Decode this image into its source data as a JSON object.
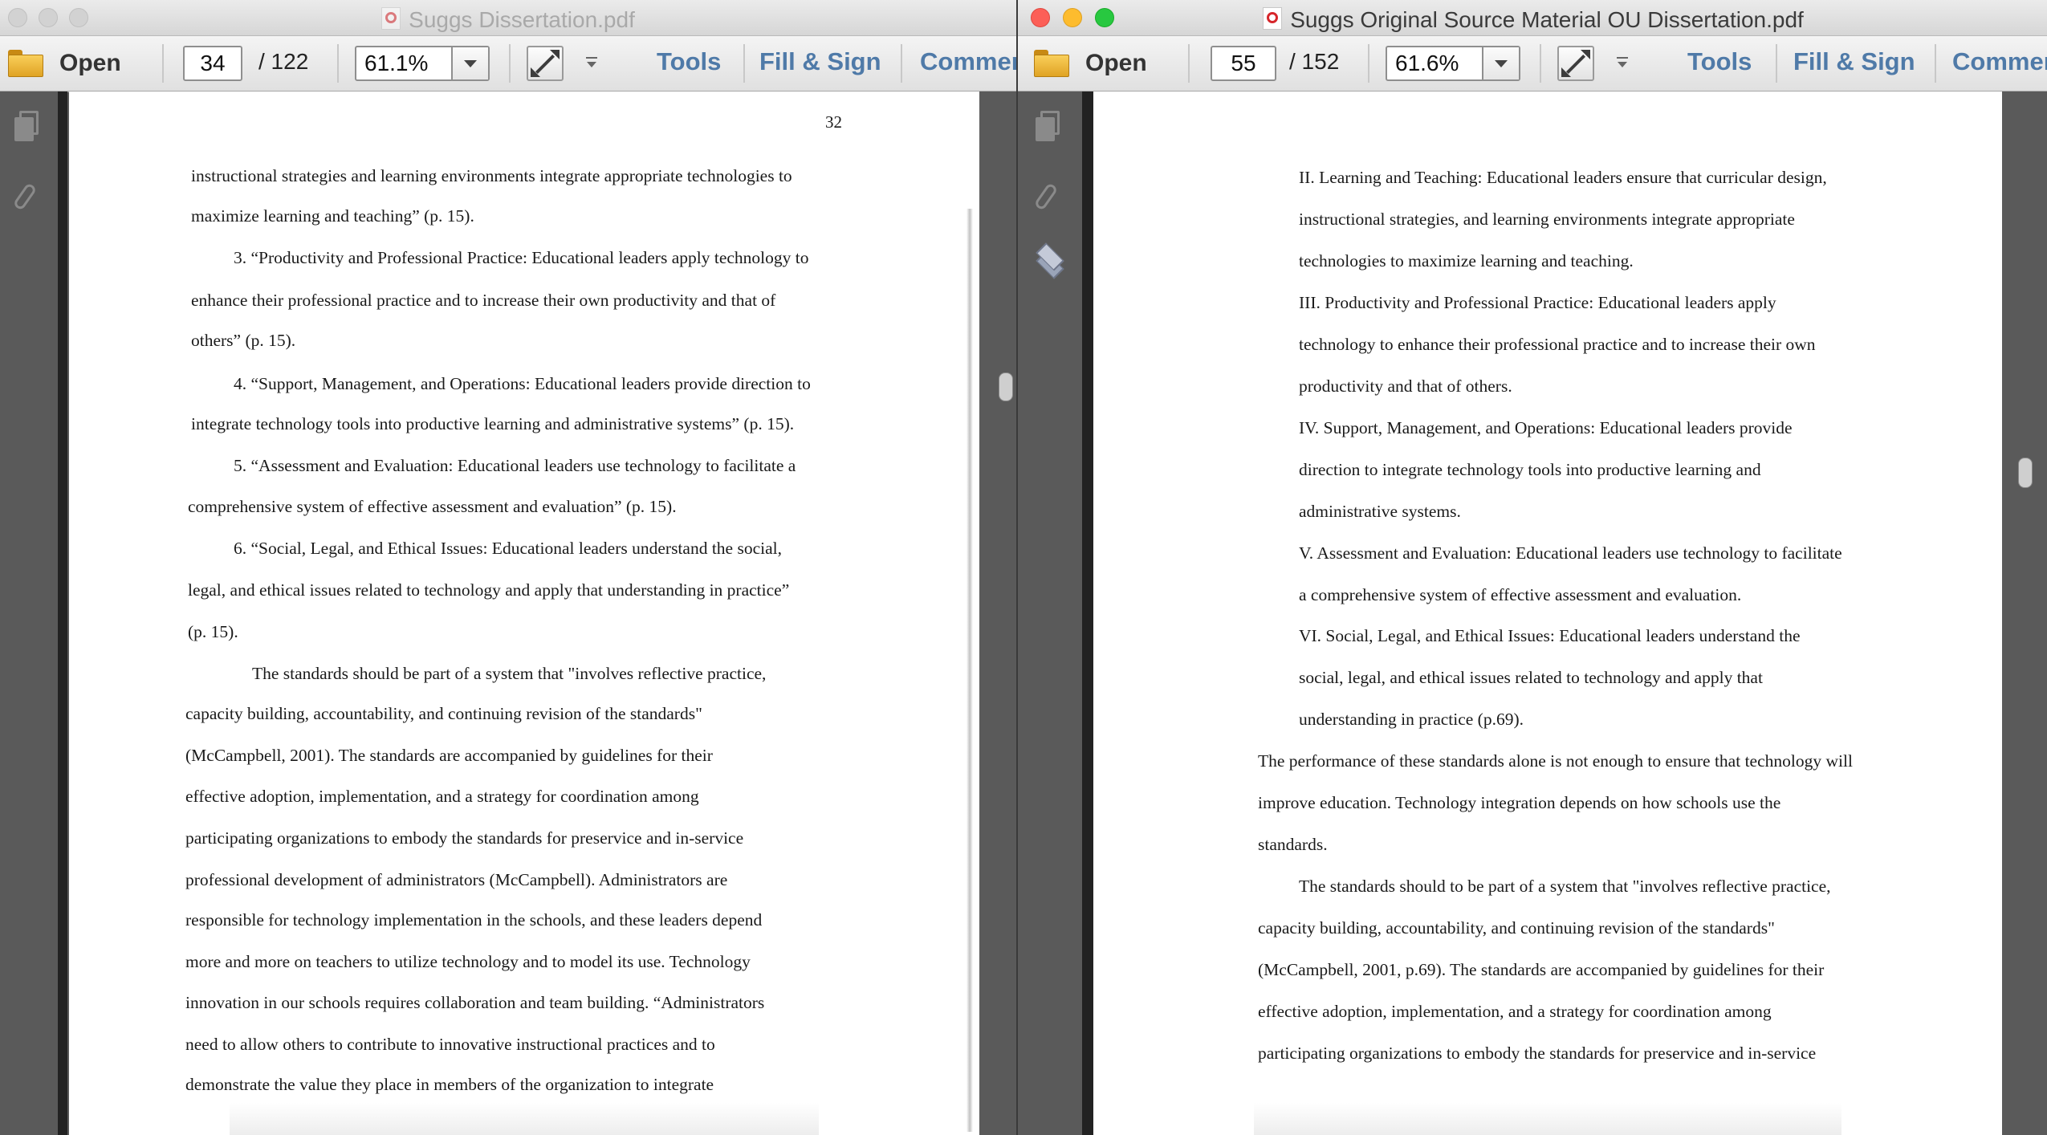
{
  "left_window": {
    "title": "Suggs Dissertation.pdf",
    "toolbar": {
      "open_label": "Open",
      "current_page": "34",
      "page_total": "/ 122",
      "zoom": "61.1%",
      "tools_label": "Tools",
      "fill_sign_label": "Fill & Sign",
      "comment_label": "Commen"
    },
    "page": {
      "page_number": "32",
      "lines": [
        "instructional strategies and learning environments integrate appropriate technologies to",
        "maximize learning and teaching” (p. 15).",
        "3. “Productivity and Professional Practice:  Educational leaders apply technology to",
        "enhance their professional practice and to increase their own productivity and that of",
        "others” (p. 15).",
        "4. “Support, Management, and Operations:  Educational leaders provide direction to",
        "integrate technology tools into productive learning and administrative systems” (p. 15).",
        "5. “Assessment and Evaluation:  Educational leaders use technology to facilitate a",
        "comprehensive system of effective assessment and evaluation” (p. 15).",
        "6. “Social, Legal, and Ethical Issues:  Educational leaders understand the social,",
        "legal, and ethical issues related to technology and apply that understanding in practice”",
        "(p. 15).",
        "The standards should be part of a system that \"involves reflective practice,",
        "capacity building, accountability, and continuing revision of the standards\"",
        "(McCampbell, 2001).  The standards are accompanied by guidelines for their",
        "effective adoption, implementation, and a strategy for coordination among",
        "participating organizations to embody the standards for preservice and in-service",
        "professional development of administrators (McCampbell).  Administrators are",
        "responsible for technology implementation in the schools, and these leaders depend",
        "more and more on teachers to utilize technology and to model its use.  Technology",
        "innovation in our schools requires collaboration and team building.  “Administrators",
        "need to allow others to contribute to innovative instructional practices and to",
        "demonstrate the value they place in members of the organization to integrate"
      ]
    }
  },
  "right_window": {
    "title": "Suggs Original Source Material OU Dissertation.pdf",
    "toolbar": {
      "open_label": "Open",
      "current_page": "55",
      "page_total": "/ 152",
      "zoom": "61.6%",
      "tools_label": "Tools",
      "fill_sign_label": "Fill & Sign",
      "comment_label": "Commen"
    },
    "page": {
      "lines": [
        "II.   Learning and Teaching:  Educational leaders ensure that curricular design,",
        "instructional strategies, and learning environments integrate appropriate",
        "technologies to maximize learning and teaching.",
        "III.   Productivity and Professional Practice:  Educational leaders apply",
        "technology to enhance their professional practice and to increase their own",
        "productivity and that of others.",
        "IV.  Support, Management, and Operations:  Educational leaders provide",
        "direction to integrate technology tools into productive learning and",
        "administrative systems.",
        "V.  Assessment and Evaluation:  Educational leaders use technology to facilitate",
        "a comprehensive system of effective assessment and evaluation.",
        "VI.  Social, Legal, and Ethical Issues:  Educational leaders understand the",
        "social, legal, and ethical issues related to technology and apply that",
        "understanding in practice (p.69).",
        "The performance of these standards alone is not enough to ensure that technology will",
        "improve education.  Technology integration depends on how schools use the",
        "standards.",
        "The standards should to be part of a system that \"involves reflective practice,",
        "capacity building, accountability, and continuing revision of the standards\"",
        "(McCampbell, 2001, p.69).  The standards are accompanied by guidelines for their",
        "effective adoption, implementation, and a strategy for coordination among",
        "participating organizations to embody the standards for preservice and in-service"
      ]
    }
  }
}
